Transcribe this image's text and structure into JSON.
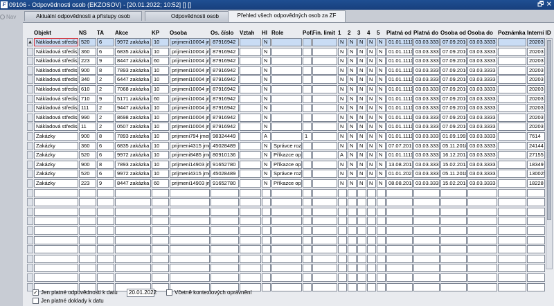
{
  "window": {
    "title": "09106 - Odpovědnosti osob (EKZOSOV) - [20.01.2022; 10:52] [] []",
    "app_icon_glyph": "F",
    "controls_glyph": "🗗 ✕"
  },
  "nav": {
    "label": "Nav"
  },
  "tabs": [
    {
      "label": "Aktuální odpovědnosti a přístupy osob",
      "active": false
    },
    {
      "label": "Odpovědnosti osob",
      "active": false
    },
    {
      "label": "Přehled všech odpovědných osob za ZF",
      "active": true
    }
  ],
  "columns": [
    "Objekt",
    "NS",
    "TA",
    "Akce",
    "KP",
    "Osoba",
    "Os. číslo",
    "Vztah",
    "HI",
    "Role",
    "Pof.",
    "Fin. limit",
    "1",
    "2",
    "3",
    "4",
    "5",
    "Platná od",
    "Platná do",
    "Osoba od",
    "Osoba do",
    "Poznámka",
    "Interní ID"
  ],
  "rows": [
    [
      "Nákladová středis",
      "520",
      "6",
      "9972 zakázka",
      "10",
      "prijmeni10004 jme",
      "87916942",
      "",
      "N",
      "",
      "",
      "",
      "N",
      "N",
      "N",
      "N",
      "N",
      "01.01.1111",
      "03.03.3333",
      "07.09.2010",
      "03.03.3333",
      "",
      "20203"
    ],
    [
      "Nákladová středis",
      "360",
      "6",
      "6835 zakázka",
      "10",
      "prijmeni10004 jme",
      "87916942",
      "",
      "N",
      "",
      "",
      "",
      "N",
      "N",
      "N",
      "N",
      "N",
      "01.01.1111",
      "03.03.3333",
      "07.09.2010",
      "03.03.3333",
      "",
      "20203"
    ],
    [
      "Nákladová středis",
      "223",
      "9",
      "8447 zakázka",
      "60",
      "prijmeni10004 jme",
      "87916942",
      "",
      "N",
      "",
      "",
      "",
      "N",
      "N",
      "N",
      "N",
      "N",
      "01.01.1111",
      "03.03.3333",
      "07.09.2010",
      "03.03.3333",
      "",
      "20203"
    ],
    [
      "Nákladová středis",
      "900",
      "8",
      "7893 zakázka",
      "10",
      "prijmeni10004 jme",
      "87916942",
      "",
      "N",
      "",
      "",
      "",
      "N",
      "N",
      "N",
      "N",
      "N",
      "01.01.1111",
      "03.03.3333",
      "07.09.2010",
      "03.03.3333",
      "",
      "20203"
    ],
    [
      "Nákladová středis",
      "340",
      "2",
      "6447 zakázka",
      "10",
      "prijmeni10004 jme",
      "87916942",
      "",
      "N",
      "",
      "",
      "",
      "N",
      "N",
      "N",
      "N",
      "N",
      "01.01.1111",
      "03.03.3333",
      "07.09.2010",
      "03.03.3333",
      "",
      "20203"
    ],
    [
      "Nákladová středis",
      "610",
      "2",
      "7068 zakázka",
      "10",
      "prijmeni10004 jme",
      "87916942",
      "",
      "N",
      "",
      "",
      "",
      "N",
      "N",
      "N",
      "N",
      "N",
      "01.01.1111",
      "03.03.3333",
      "07.09.2010",
      "03.03.3333",
      "",
      "20203"
    ],
    [
      "Nákladová středis",
      "710",
      "9",
      "5171 zakázka",
      "60",
      "prijmeni10004 jme",
      "87916942",
      "",
      "N",
      "",
      "",
      "",
      "N",
      "N",
      "N",
      "N",
      "N",
      "01.01.1111",
      "03.03.3333",
      "07.09.2010",
      "03.03.3333",
      "",
      "20203"
    ],
    [
      "Nákladová středis",
      "111",
      "2",
      "9447 zakázka",
      "10",
      "prijmeni10004 jme",
      "87916942",
      "",
      "N",
      "",
      "",
      "",
      "N",
      "N",
      "N",
      "N",
      "N",
      "01.01.1111",
      "03.03.3333",
      "07.09.2010",
      "03.03.3333",
      "",
      "20203"
    ],
    [
      "Nákladová středis",
      "990",
      "2",
      "8698 zakázka",
      "10",
      "prijmeni10004 jme",
      "87916942",
      "",
      "N",
      "",
      "",
      "",
      "N",
      "N",
      "N",
      "N",
      "N",
      "01.01.1111",
      "03.03.3333",
      "07.09.2010",
      "03.03.3333",
      "",
      "20203"
    ],
    [
      "Nákladová středis",
      "11",
      "2",
      "0507 zakázka",
      "10",
      "prijmeni10004 jme",
      "87916942",
      "",
      "N",
      "",
      "",
      "",
      "N",
      "N",
      "N",
      "N",
      "N",
      "01.01.1111",
      "03.03.3333",
      "07.09.2010",
      "03.03.3333",
      "",
      "20203"
    ],
    [
      "Zakázky",
      "900",
      "8",
      "7893 zakázka",
      "10",
      "prijmeni794 jmeno",
      "98324449",
      "",
      "A",
      "",
      "1",
      "",
      "N",
      "N",
      "N",
      "N",
      "N",
      "01.01.1111",
      "03.03.3333",
      "01.09.1992",
      "03.03.3333",
      "",
      "7614"
    ],
    [
      "Zakázky",
      "360",
      "6",
      "6835 zakázka",
      "10",
      "prijmeni4315 jmen",
      "45028489",
      "",
      "N",
      "Správce roz",
      "",
      "",
      "N",
      "N",
      "N",
      "N",
      "N",
      "07.07.2019",
      "03.03.3333",
      "05.11.2018",
      "03.03.3333",
      "",
      "24144"
    ],
    [
      "Zakázky",
      "520",
      "6",
      "9972 zakázka",
      "10",
      "prijmeni8485 jmen",
      "80910136",
      "",
      "N",
      "Příkazce ope",
      "",
      "",
      "A",
      "N",
      "N",
      "N",
      "N",
      "01.01.1111",
      "03.03.3333",
      "16.12.2013",
      "03.03.3333",
      "",
      "27155"
    ],
    [
      "Zakázky",
      "900",
      "8",
      "7893 zakázka",
      "10",
      "prijmeni14903 jme",
      "91652780",
      "",
      "N",
      "Příkazce ope",
      "",
      "",
      "N",
      "N",
      "N",
      "N",
      "N",
      "13.08.2018",
      "03.03.3333",
      "15.02.2018",
      "03.03.3333",
      "",
      "18349"
    ],
    [
      "Zakázky",
      "520",
      "6",
      "9972 zakázka",
      "10",
      "prijmeni4315 jmen",
      "45028489",
      "",
      "N",
      "Správce roz",
      "",
      "",
      "N",
      "N",
      "N",
      "N",
      "N",
      "01.01.2021",
      "03.03.3333",
      "05.11.2018",
      "03.03.3333",
      "",
      "130025"
    ],
    [
      "Zakázky",
      "223",
      "9",
      "8447 zakázka",
      "60",
      "prijmeni14903 jme",
      "91652780",
      "",
      "N",
      "Příkazce ope",
      "",
      "",
      "N",
      "N",
      "N",
      "N",
      "N",
      "08.08.2018",
      "03.03.3333",
      "15.02.2018",
      "03.03.3333",
      "",
      "18228"
    ]
  ],
  "empty_row_count": 11,
  "row_marker_glyph": "▲",
  "filters": {
    "valid_resp_label": "Jen platné odpovědnosti k datu",
    "valid_resp_checked": true,
    "date_value": "20.01.2022",
    "context_label": "Včetně kontextových oprávnění",
    "context_checked": false,
    "valid_docs_label": "Jen platné doklady k datu",
    "valid_docs_checked": false,
    "check_glyph": "✓"
  }
}
